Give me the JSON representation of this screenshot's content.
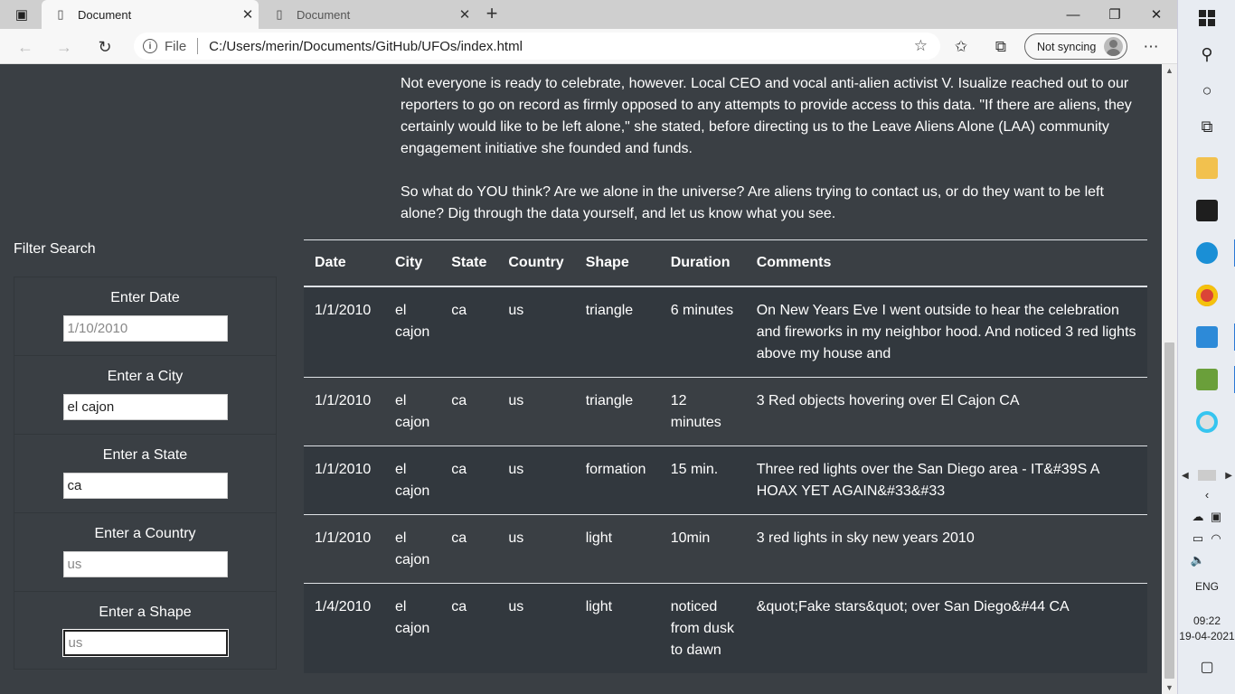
{
  "browser": {
    "tabs": [
      {
        "title": "Document",
        "active": true
      },
      {
        "title": "Document",
        "active": false
      }
    ],
    "address": {
      "prefix": "File",
      "url": "C:/Users/merin/Documents/GitHub/UFOs/index.html"
    },
    "sync_label": "Not syncing"
  },
  "article": {
    "paragraphs": [
      "Not everyone is ready to celebrate, however. Local CEO and vocal anti-alien activist V. Isualize reached out to our reporters to go on record as firmly opposed to any attempts to provide access to this data. \"If there are aliens, they certainly would like to be left alone,\" she stated, before directing us to the Leave Aliens Alone (LAA) community engagement initiative she founded and funds.",
      "So what do YOU think? Are we alone in the universe? Are aliens trying to contact us, or do they want to be left alone? Dig through the data yourself, and let us know what you see."
    ]
  },
  "filters": {
    "title": "Filter Search",
    "items": [
      {
        "label": "Enter Date",
        "value": "",
        "placeholder": "1/10/2010"
      },
      {
        "label": "Enter a City",
        "value": "el cajon",
        "placeholder": ""
      },
      {
        "label": "Enter a State",
        "value": "ca",
        "placeholder": ""
      },
      {
        "label": "Enter a Country",
        "value": "",
        "placeholder": "us"
      },
      {
        "label": "Enter a Shape",
        "value": "",
        "placeholder": "us"
      }
    ]
  },
  "table": {
    "headers": [
      "Date",
      "City",
      "State",
      "Country",
      "Shape",
      "Duration",
      "Comments"
    ],
    "rows": [
      {
        "date": "1/1/2010",
        "city": "el cajon",
        "state": "ca",
        "country": "us",
        "shape": "triangle",
        "duration": "6 minutes",
        "comments": "On New Years Eve I went outside to hear the celebration and fireworks in my neighbor hood. And noticed 3 red lights above my house and"
      },
      {
        "date": "1/1/2010",
        "city": "el cajon",
        "state": "ca",
        "country": "us",
        "shape": "triangle",
        "duration": "12 minutes",
        "comments": "3 Red objects hovering over El Cajon CA"
      },
      {
        "date": "1/1/2010",
        "city": "el cajon",
        "state": "ca",
        "country": "us",
        "shape": "formation",
        "duration": "15 min.",
        "comments": "Three red lights over the San Diego area - IT&#39S A HOAX YET AGAIN&#33&#33"
      },
      {
        "date": "1/1/2010",
        "city": "el cajon",
        "state": "ca",
        "country": "us",
        "shape": "light",
        "duration": "10min",
        "comments": "3 red lights in sky new years 2010"
      },
      {
        "date": "1/4/2010",
        "city": "el cajon",
        "state": "ca",
        "country": "us",
        "shape": "light",
        "duration": "noticed from dusk to dawn",
        "comments": "&quot;Fake stars&quot; over San Diego&#44 CA"
      }
    ]
  },
  "taskbar": {
    "language": "ENG",
    "time": "09:22",
    "date": "19-04-2021"
  },
  "colors": {
    "page_background": "#3a3f44",
    "table_striped_row": "#32383e",
    "taskbar_accent": "#2b79d6"
  }
}
